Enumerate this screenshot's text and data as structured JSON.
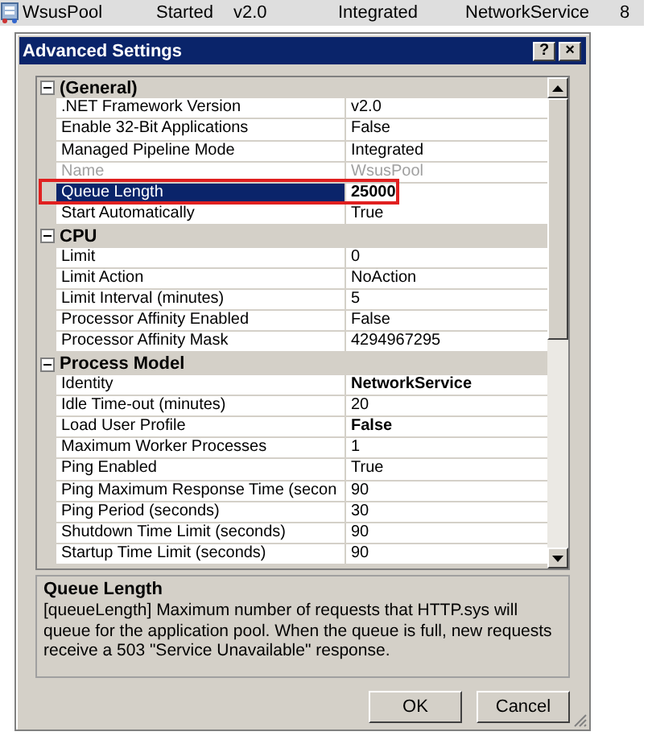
{
  "pool_row": {
    "name": "WsusPool",
    "status": "Started",
    "version": "v2.0",
    "pipeline": "Integrated",
    "identity": "NetworkService",
    "applications": "8"
  },
  "dialog": {
    "title": "Advanced Settings",
    "help": "?",
    "close": "×",
    "categories": [
      {
        "name": "(General)",
        "expanded": true,
        "properties": [
          {
            "name": ".NET Framework Version",
            "value": "v2.0",
            "bold": false,
            "readonly": false,
            "selected": false
          },
          {
            "name": "Enable 32-Bit Applications",
            "value": "False",
            "bold": false,
            "readonly": false,
            "selected": false
          },
          {
            "name": "Managed Pipeline Mode",
            "value": "Integrated",
            "bold": false,
            "readonly": false,
            "selected": false
          },
          {
            "name": "Name",
            "value": "WsusPool",
            "bold": false,
            "readonly": true,
            "selected": false
          },
          {
            "name": "Queue Length",
            "value": "25000",
            "bold": true,
            "readonly": false,
            "selected": true
          },
          {
            "name": "Start Automatically",
            "value": "True",
            "bold": false,
            "readonly": false,
            "selected": false
          }
        ]
      },
      {
        "name": "CPU",
        "expanded": true,
        "properties": [
          {
            "name": "Limit",
            "value": "0",
            "bold": false,
            "readonly": false,
            "selected": false
          },
          {
            "name": "Limit Action",
            "value": "NoAction",
            "bold": false,
            "readonly": false,
            "selected": false
          },
          {
            "name": "Limit Interval (minutes)",
            "value": "5",
            "bold": false,
            "readonly": false,
            "selected": false
          },
          {
            "name": "Processor Affinity Enabled",
            "value": "False",
            "bold": false,
            "readonly": false,
            "selected": false
          },
          {
            "name": "Processor Affinity Mask",
            "value": "4294967295",
            "bold": false,
            "readonly": false,
            "selected": false
          }
        ]
      },
      {
        "name": "Process Model",
        "expanded": true,
        "properties": [
          {
            "name": "Identity",
            "value": "NetworkService",
            "bold": true,
            "readonly": false,
            "selected": false
          },
          {
            "name": "Idle Time-out (minutes)",
            "value": "20",
            "bold": false,
            "readonly": false,
            "selected": false
          },
          {
            "name": "Load User Profile",
            "value": "False",
            "bold": true,
            "readonly": false,
            "selected": false
          },
          {
            "name": "Maximum Worker Processes",
            "value": "1",
            "bold": false,
            "readonly": false,
            "selected": false
          },
          {
            "name": "Ping Enabled",
            "value": "True",
            "bold": false,
            "readonly": false,
            "selected": false
          },
          {
            "name": "Ping Maximum Response Time (secon",
            "value": "90",
            "bold": false,
            "readonly": false,
            "selected": false
          },
          {
            "name": "Ping Period (seconds)",
            "value": "30",
            "bold": false,
            "readonly": false,
            "selected": false
          },
          {
            "name": "Shutdown Time Limit (seconds)",
            "value": "90",
            "bold": false,
            "readonly": false,
            "selected": false
          },
          {
            "name": "Startup Time Limit (seconds)",
            "value": "90",
            "bold": false,
            "readonly": false,
            "selected": false
          }
        ]
      }
    ],
    "description": {
      "title": "Queue Length",
      "text": "[queueLength] Maximum number of requests that HTTP.sys will queue for the application pool. When the queue is full, new requests receive a 503 \"Service Unavailable\" response."
    },
    "buttons": [
      "OK",
      "Cancel"
    ]
  }
}
